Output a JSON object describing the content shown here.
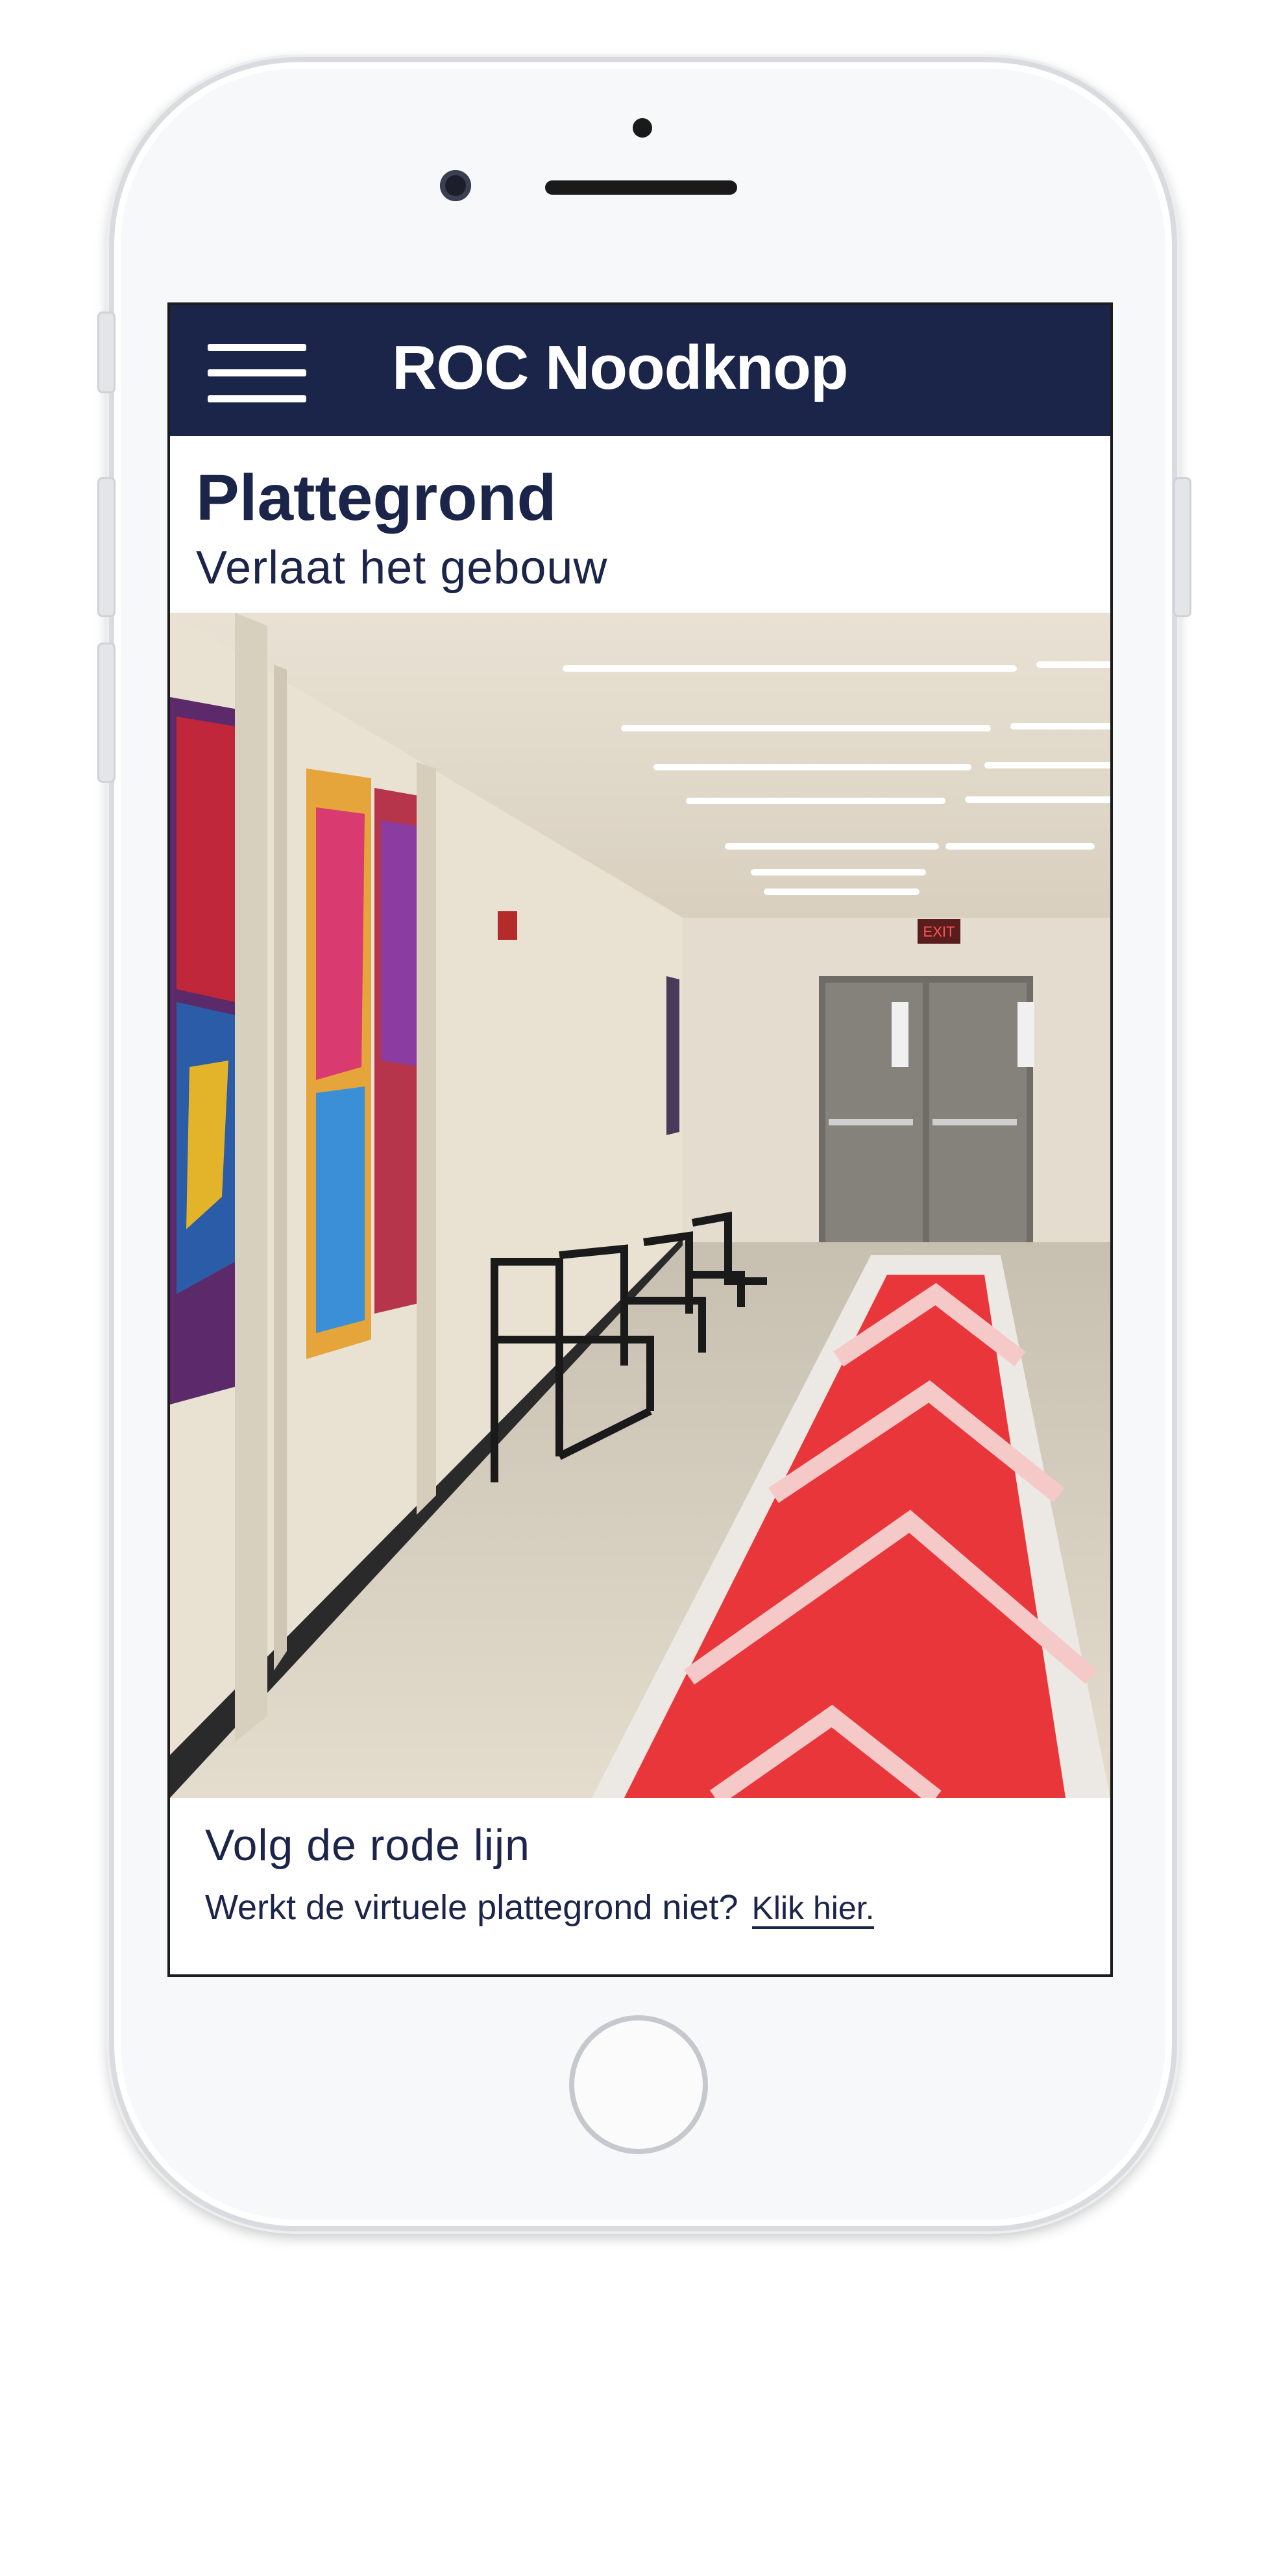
{
  "app": {
    "title": "ROC Noodknop"
  },
  "menu": {
    "icon": "hamburger-menu-icon"
  },
  "page": {
    "title": "Plattegrond",
    "subtitle": "Verlaat het gebouw"
  },
  "map_view": {
    "image": "corridor-with-red-route-arrow",
    "exit_sign": "EXIT"
  },
  "footer": {
    "title": "Volg de rode lijn",
    "text": "Werkt de virtuele plattegrond niet?",
    "link": "Klik hier."
  },
  "device": {
    "home_button": "home-button-icon"
  },
  "colors": {
    "navy": "#1b2449",
    "route_red": "#e8363a"
  }
}
